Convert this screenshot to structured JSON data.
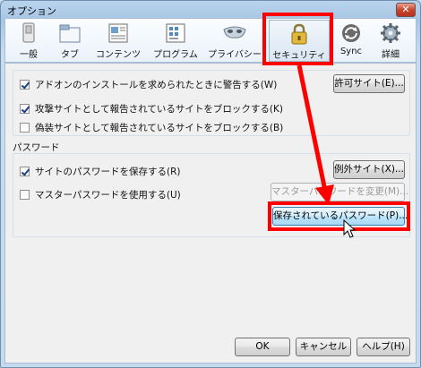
{
  "window": {
    "title": "オプション",
    "close_symbol": "✕"
  },
  "tabs": [
    {
      "id": "general",
      "label": "一般",
      "icon": "switch-icon"
    },
    {
      "id": "tabs",
      "label": "タブ",
      "icon": "tab-window-icon"
    },
    {
      "id": "content",
      "label": "コンテンツ",
      "icon": "content-page-icon"
    },
    {
      "id": "applications",
      "label": "プログラム",
      "icon": "applications-icon"
    },
    {
      "id": "privacy",
      "label": "プライバシー",
      "icon": "mask-icon"
    },
    {
      "id": "security",
      "label": "セキュリティ",
      "icon": "padlock-icon",
      "selected": true
    },
    {
      "id": "sync",
      "label": "Sync",
      "icon": "sync-icon"
    },
    {
      "id": "advanced",
      "label": "詳細",
      "icon": "gear-icon"
    }
  ],
  "security": {
    "addon_warn": {
      "label": "アドオンのインストールを求められたときに警告する(W)",
      "checked": true
    },
    "exceptions_button": "許可サイト(E)...",
    "block_attack": {
      "label": "攻撃サイトとして報告されているサイトをブロックする(K)",
      "checked": true
    },
    "block_forgery": {
      "label": "偽装サイトとして報告されているサイトをブロックする(B)",
      "checked": false
    }
  },
  "passwords": {
    "group_label": "パスワード",
    "remember": {
      "label": "サイトのパスワードを保存する(R)",
      "checked": true
    },
    "exceptions_button": "例外サイト(X)...",
    "master": {
      "label": "マスターパスワードを使用する(U)",
      "checked": false
    },
    "change_master_button": "マスターパスワードを変更(M)...",
    "saved_passwords_button": "保存されているパスワード(P)..."
  },
  "footer": {
    "ok": "OK",
    "cancel": "キャンセル",
    "help": "ヘルプ(H)"
  },
  "colors": {
    "annotation": "#ff0000",
    "accent": "#3c7fb1"
  }
}
